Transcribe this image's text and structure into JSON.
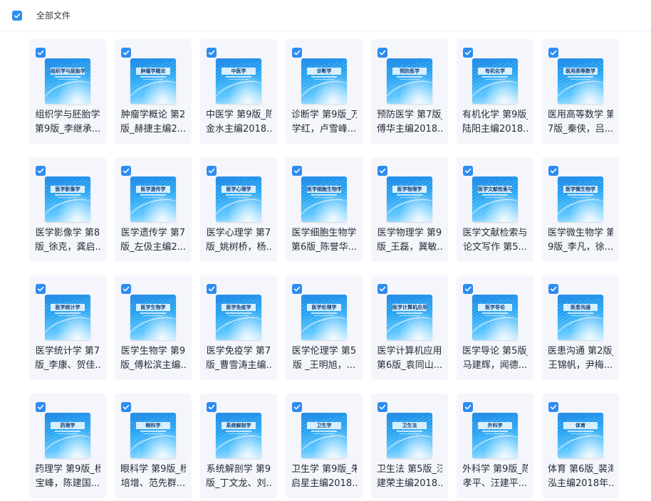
{
  "header": {
    "select_all_label": "全部文件",
    "select_all_checked": true
  },
  "colors": {
    "accent": "#2e8cf0",
    "card_bg": "#f4f6fb"
  },
  "icons": {
    "checkbox": "checkmark-icon",
    "file_cover": "book-cover-thumbnail"
  },
  "files": [
    {
      "title": "组织学与胚胎学",
      "line1": "组织学与胚胎学",
      "line2": "第9版_李继承...",
      "checked": true
    },
    {
      "title": "肿瘤学概论",
      "line1": "肿瘤学概论 第2",
      "line2": "版_赫捷主编2...",
      "checked": true
    },
    {
      "title": "中医学",
      "line1": "中医学 第9版_陈",
      "line2": "金水主编2018...",
      "checked": true
    },
    {
      "title": "诊断学",
      "line1": "诊断学 第9版_万",
      "line2": "学红，卢雪峰...",
      "checked": true
    },
    {
      "title": "预防医学",
      "line1": "预防医学 第7版_",
      "line2": "傅华主编2018...",
      "checked": true
    },
    {
      "title": "有机化学",
      "line1": "有机化学 第9版_",
      "line2": "陆阳主编2018...",
      "checked": true
    },
    {
      "title": "医用高等数学",
      "line1": "医用高等数学 第",
      "line2": "7版_秦侠，吕...",
      "checked": true
    },
    {
      "title": "医学影像学",
      "line1": "医学影像学 第8",
      "line2": "版_徐克，龚启...",
      "checked": true
    },
    {
      "title": "医学遗传学",
      "line1": "医学遗传学 第7",
      "line2": "版_左伋主编2...",
      "checked": true
    },
    {
      "title": "医学心理学",
      "line1": "医学心理学 第7",
      "line2": "版_姚树桥，杨...",
      "checked": true
    },
    {
      "title": "医学细胞生物学",
      "line1": "医学细胞生物学",
      "line2": "第6版_陈誉华...",
      "checked": true
    },
    {
      "title": "医学物理学",
      "line1": "医学物理学 第9",
      "line2": "版_王磊，冀敏...",
      "checked": true
    },
    {
      "title": "医学文献检索与论文写作",
      "line1": "医学文献检索与",
      "line2": "论文写作 第5...",
      "checked": true
    },
    {
      "title": "医学微生物学",
      "line1": "医学微生物学 第",
      "line2": "9版_李凡，徐...",
      "checked": true
    },
    {
      "title": "医学统计学",
      "line1": "医学统计学 第7",
      "line2": "版_李康、贺佳...",
      "checked": true
    },
    {
      "title": "医学生物学",
      "line1": "医学生物学 第9",
      "line2": "版_傅松滨主编...",
      "checked": true
    },
    {
      "title": "医学免疫学",
      "line1": "医学免疫学 第7",
      "line2": "版_曹雪涛主编...",
      "checked": true
    },
    {
      "title": "医学伦理学",
      "line1": "医学伦理学 第5",
      "line2": "版 _王明旭，...",
      "checked": true
    },
    {
      "title": "医学计算机应用",
      "line1": "医学计算机应用",
      "line2": "第6版_袁同山...",
      "checked": true
    },
    {
      "title": "医学导论",
      "line1": "医学导论 第5版_",
      "line2": "马建辉，闻德...",
      "checked": true
    },
    {
      "title": "医患沟通",
      "line1": "医患沟通 第2版_",
      "line2": "王锦帆，尹梅...",
      "checked": true
    },
    {
      "title": "药理学",
      "line1": "药理学 第9版_杨",
      "line2": "宝峰，陈建国...",
      "checked": true
    },
    {
      "title": "眼科学",
      "line1": "眼科学 第9版_杨",
      "line2": "培增、范先群...",
      "checked": true
    },
    {
      "title": "系统解剖学",
      "line1": "系统解剖学 第9",
      "line2": "版_丁文龙、刘...",
      "checked": true
    },
    {
      "title": "卫生学",
      "line1": "卫生学 第9版_朱",
      "line2": "启星主编2018...",
      "checked": true
    },
    {
      "title": "卫生法",
      "line1": "卫生法 第5版_汪",
      "line2": "建荣主编2018...",
      "checked": true
    },
    {
      "title": "外科学",
      "line1": "外科学 第9版_陈",
      "line2": "孝平、汪建平...",
      "checked": true
    },
    {
      "title": "体育",
      "line1": "体育 第6版_裴海",
      "line2": "泓主编2018年...",
      "checked": true
    }
  ]
}
